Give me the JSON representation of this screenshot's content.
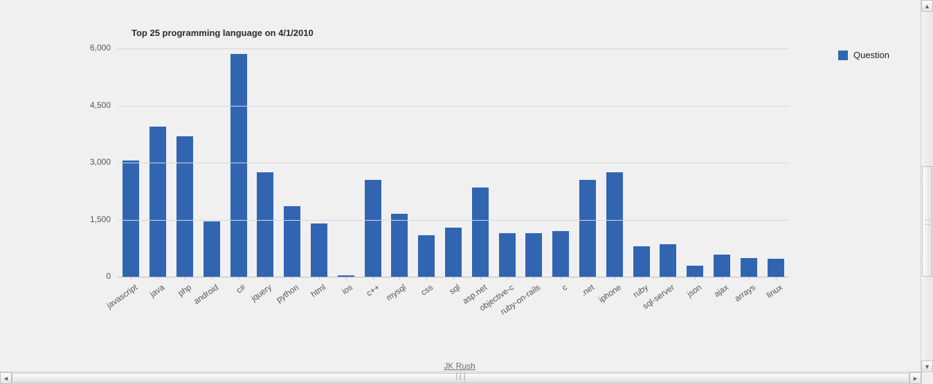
{
  "chart_data": {
    "type": "bar",
    "title": "Top 25 programming language on 4/1/2010",
    "xlabel": "",
    "ylabel": "",
    "ylim": [
      0,
      6000
    ],
    "yticks": [
      0,
      1500,
      3000,
      4500,
      6000
    ],
    "yticklabels": [
      "0",
      "1,500",
      "3,000",
      "4,500",
      "6,000"
    ],
    "categories": [
      "javascript",
      "java",
      "php",
      "android",
      "c#",
      "jquery",
      "python",
      "html",
      "ios",
      "c++",
      "mysql",
      "css",
      "sql",
      "asp.net",
      "objective-c",
      "ruby-on-rails",
      "c",
      ".net",
      "iphone",
      "ruby",
      "sql-server",
      "json",
      "ajax",
      "arrays",
      "linux"
    ],
    "series": [
      {
        "name": "Question",
        "color": "#3165b2",
        "values": [
          3050,
          3950,
          3700,
          1450,
          5850,
          2750,
          1850,
          1400,
          40,
          2550,
          1650,
          1100,
          1300,
          2350,
          1150,
          1150,
          1200,
          2550,
          2750,
          800,
          850,
          300,
          580,
          500,
          470
        ]
      }
    ],
    "legend_position": "right",
    "grid": true
  },
  "footer": {
    "credit": "JK Rush"
  },
  "scroll": {
    "up_glyph": "▲",
    "down_glyph": "▼",
    "left_glyph": "◄",
    "right_glyph": "►",
    "h_grip": "׀׀׀"
  }
}
